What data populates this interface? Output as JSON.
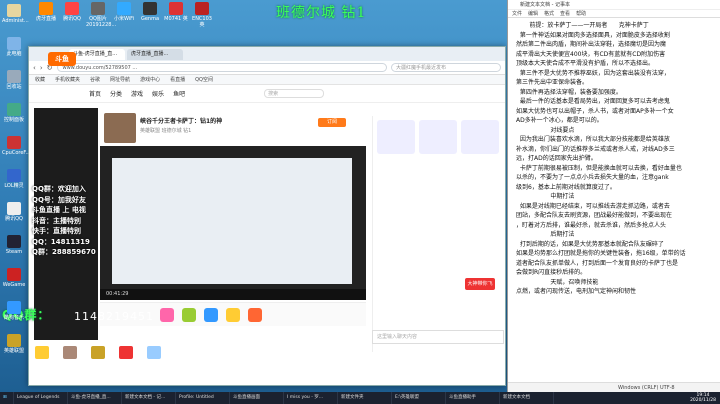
{
  "banner": "班德尔城    钻1",
  "desktop_icons": [
    {
      "label": "Administ...",
      "color": "#e6d6a0"
    },
    {
      "label": "此电脑",
      "color": "#7fb4e8"
    },
    {
      "label": "回收站",
      "color": "#9ab"
    },
    {
      "label": "控制面板",
      "color": "#4a8"
    },
    {
      "label": "CpuCoreF...",
      "color": "#c33"
    },
    {
      "label": "LOL精灵",
      "color": "#36c"
    },
    {
      "label": "腾讯QQ",
      "color": "#eee"
    },
    {
      "label": "Steam",
      "color": "#223"
    },
    {
      "label": "WeGame",
      "color": "#c22"
    },
    {
      "label": "酷狗音乐",
      "color": "#39f"
    },
    {
      "label": "英雄联盟",
      "color": "#c9a227"
    }
  ],
  "top_icons": [
    {
      "label": "虎牙直播",
      "color": "#f80"
    },
    {
      "label": "腾讯QQ",
      "color": "#f44"
    },
    {
      "label": "QQ图片20191228...",
      "color": "#666"
    },
    {
      "label": "小米WiFi",
      "color": "#3af"
    },
    {
      "label": "Genma",
      "color": "#333"
    },
    {
      "label": "M0741 英",
      "color": "#d33"
    },
    {
      "label": "ENC103 英",
      "color": "#b22"
    }
  ],
  "bottom_icons": [
    {
      "label": "一年计",
      "color": "#fc3"
    },
    {
      "label": "QQ图片20200924...",
      "color": "#a87"
    },
    {
      "label": "英雄联盟",
      "color": "#c9a227"
    },
    {
      "label": "一百个分",
      "color": "#e33"
    },
    {
      "label": "天涯明月刀",
      "color": "#9cf"
    }
  ],
  "browser": {
    "tabs": [
      "斗鱼-虎牙直播_直...",
      "虎牙直播_直播..."
    ],
    "url": "www.douyu.com/52789507 ...",
    "search_placeholder": "大疆红魔手机最近发布",
    "bookmarks": [
      "收藏",
      "手机收藏夹",
      "谷歌",
      "网址导航",
      "游戏中心",
      "看直播",
      "QQ空间"
    ],
    "site_nav": [
      "首页",
      "分类",
      "游戏",
      "娱乐",
      "鱼吧"
    ],
    "site_logo": "斗鱼",
    "site_search_placeholder": "搜索",
    "room_title": "峡谷千分王者卡萨丁：钻1的神",
    "room_info": "英雄联盟  班德尔城  钻1",
    "follow_label": "订阅",
    "video_time": "00:41:29",
    "chat_placeholder": "这里输入聊天内容",
    "cta": "大神带你飞"
  },
  "overlay_lines": [
    "QQ群：欢迎加入",
    "QQ号：加我好友",
    "斗鱼直播 上 电视",
    "抖音：主播特别",
    "快手：直播特别",
    "QQ：14811319",
    "Q群：288859670"
  ],
  "qq_label": "QQ群：",
  "qq_number": "1148219451",
  "notepad": {
    "title": "新建文本文档 - 记事本",
    "menu": [
      "文件",
      "编辑",
      "格式",
      "查看",
      "帮助"
    ],
    "text": "       前提：放卡萨丁——一开局者      克神卡萨丁\n  第一件神话如果对面肉多选择面具，对面脆皮多选择收割\n然后第二件出肉盾，期间补出法穿鞋，选择魔切是因为魔\n成平滑出大天使便宜400块，有CD有蓝就有CD附加伤害\n顶级本大天使合成不平滑没有护盾，所以不选择出。\n  第三件不是大优势不推荐巫妖，因为这套出装没有法穿，\n第三件先出中亚保命装备。\n  第四件再选择法穿帽，装备要加强度。\n  最后一件的话基本是看局势出，对面回复多可以去考虑鬼\n如果大优势也可以出帽子，杀人书，或者对面AP多补一个女\nAD多补一个冰心，都是可以的。\n                  对线要点\n  因为我出门装喜欢水滴，所以我大部分技能都是给英雄放\n补水滴，你们出门的话推荐多兰戒或者杀人戒，对线AD多三\n远，打AD的话回家先出护臂。\n  卡萨丁前期很易被压制，但是能换血就可以去换，看好血量也\n以杀的，不要为了一点点小兵去损失大量的血，注意gank\n级到6，基本上前期对线就算度过了。\n                  中期打法\n  如果是对线期已经结束，可以推线去游走抓边路，或者去\n团站，多配合队友去刷资源，团战最好能做到，不要出现在\n，盯着对方后排，谁最好杀，就去杀谁，然后多抢点人头\n                  后期打法\n  打到后期的话，如果是大优势那基本就配合队友碾碎了\n如果是均势那么打团就是拖你的关键性装备，拖16级，单带的话\n道者配合队友抓单做人，打到后面一个发育良好的卡萨丁也是\n会做到R闪直接秒后排的。\n                  天赋，召唤师技能\n点燃，或者闪现传送，电刑加气定神闲和韧性",
    "status": "Windows (CRLF)   UTF-8"
  },
  "taskbar": [
    "League of Legends",
    "斗鱼-虎牙直播_直...",
    "新建文本文档 - 记...",
    "Profile: Untitled",
    "斗鱼直播画面",
    "I miss you - 罗...",
    "新建文件夹",
    "E:\\英雄联盟",
    "斗鱼直播助手",
    "新建文本文档"
  ],
  "clock": {
    "time": "19:14",
    "date": "2020/11/28"
  }
}
